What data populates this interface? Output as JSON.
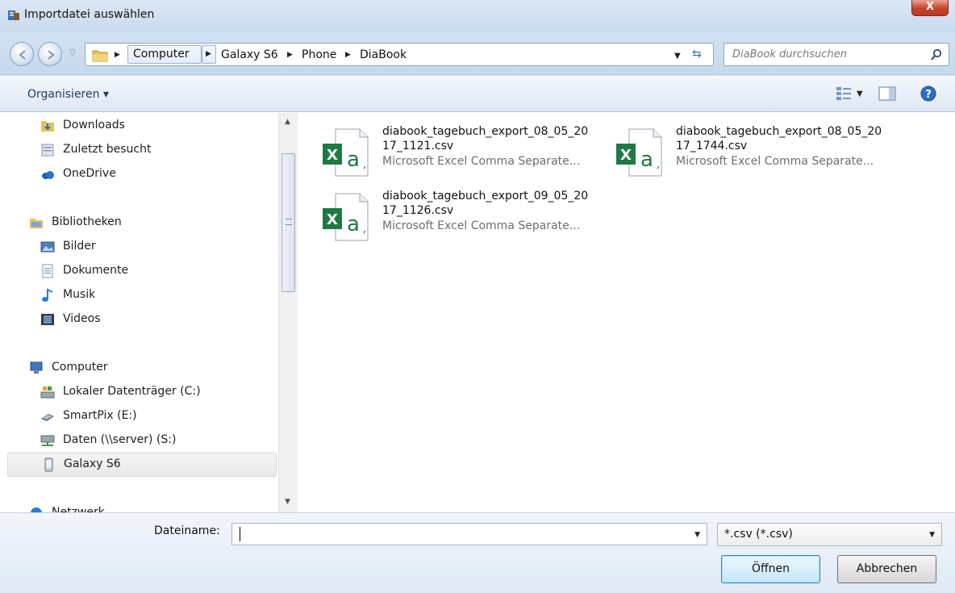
{
  "window": {
    "title": "Importdatei auswählen",
    "close_label": "X"
  },
  "address": {
    "breadcrumbs": [
      "Computer",
      "Galaxy S6",
      "Phone",
      "DiaBook"
    ],
    "search_placeholder": "DiaBook durchsuchen"
  },
  "toolbar": {
    "organize_label": "Organisieren ▾"
  },
  "sidebar": {
    "items": [
      {
        "label": "Downloads",
        "icon": "downloads-folder-icon"
      },
      {
        "label": "Zuletzt besucht",
        "icon": "recent-places-icon"
      },
      {
        "label": "OneDrive",
        "icon": "onedrive-cloud-icon"
      },
      {
        "label": "Bibliotheken",
        "icon": "libraries-icon"
      },
      {
        "label": "Bilder",
        "icon": "pictures-icon"
      },
      {
        "label": "Dokumente",
        "icon": "documents-icon"
      },
      {
        "label": "Musik",
        "icon": "music-icon"
      },
      {
        "label": "Videos",
        "icon": "videos-icon"
      },
      {
        "label": "Computer",
        "icon": "computer-icon"
      },
      {
        "label": "Lokaler Datenträger (C:)",
        "icon": "local-disk-icon"
      },
      {
        "label": "SmartPix (E:)",
        "icon": "removable-drive-icon"
      },
      {
        "label": "Daten (\\\\server) (S:)",
        "icon": "network-drive-icon"
      },
      {
        "label": "Galaxy S6",
        "icon": "phone-device-icon",
        "selected": true
      },
      {
        "label": "Netzwerk",
        "icon": "network-icon"
      }
    ]
  },
  "files": [
    {
      "name_line1": "diabook_tagebuch_export_08_05_20",
      "name_line2": "17_1121.csv",
      "type": "Microsoft Excel Comma Separate..."
    },
    {
      "name_line1": "diabook_tagebuch_export_08_05_20",
      "name_line2": "17_1744.csv",
      "type": "Microsoft Excel Comma Separate..."
    },
    {
      "name_line1": "diabook_tagebuch_export_09_05_20",
      "name_line2": "17_1126.csv",
      "type": "Microsoft Excel Comma Separate..."
    }
  ],
  "footer": {
    "filename_label": "Dateiname:",
    "filename_value": "",
    "filetype_selected": "*.csv (*.csv)",
    "open_label": "Öffnen",
    "cancel_label": "Abbrechen"
  },
  "colors": {
    "excel_green": "#1e7a45",
    "selection_bg": "#e8e8e8",
    "titlebar_bg": "#d3e2f3"
  }
}
